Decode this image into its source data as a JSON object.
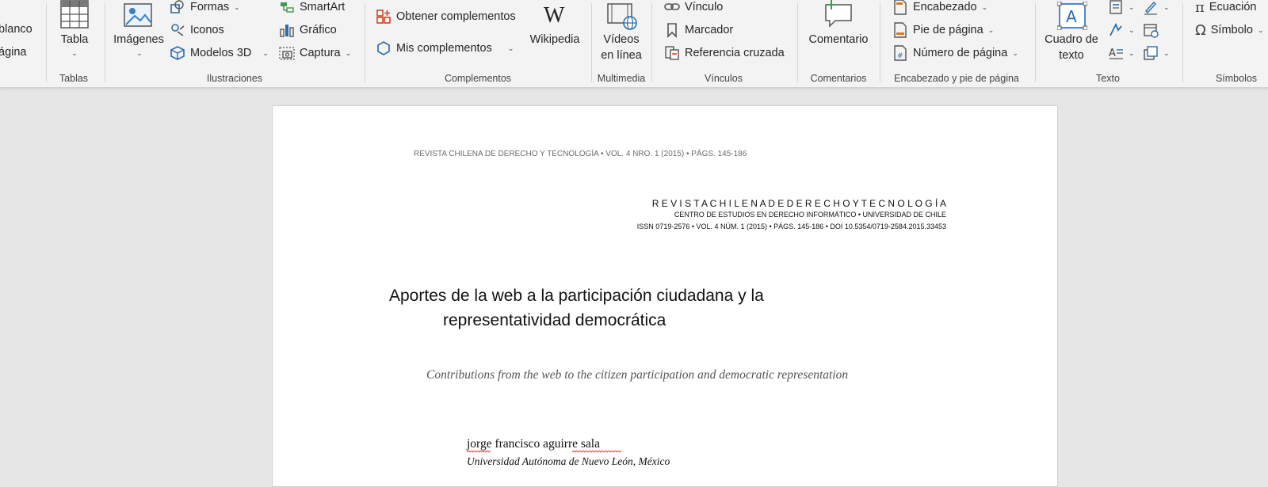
{
  "ribbon": {
    "cut_left": {
      "line1": "blanco",
      "line2": "ágina"
    },
    "tablas": {
      "button": "Tabla",
      "group": "Tablas"
    },
    "ilustraciones": {
      "imagenes": "Imágenes",
      "formas": "Formas",
      "iconos": "Iconos",
      "modelos3d": "Modelos 3D",
      "smartart": "SmartArt",
      "grafico": "Gráfico",
      "captura": "Captura",
      "group": "Ilustraciones"
    },
    "complementos": {
      "obtener": "Obtener complementos",
      "mis": "Mis complementos",
      "wikipedia": "Wikipedia",
      "group": "Complementos"
    },
    "multimedia": {
      "videos_line1": "Vídeos",
      "videos_line2": "en línea",
      "group": "Multimedia"
    },
    "vinculos": {
      "vinculo": "Vínculo",
      "marcador": "Marcador",
      "referencia": "Referencia cruzada",
      "group": "Vínculos"
    },
    "comentarios": {
      "comentario": "Comentario",
      "group": "Comentarios"
    },
    "encabezado": {
      "encabezado": "Encabezado",
      "pie": "Pie de página",
      "numero": "Número de página",
      "group": "Encabezado y pie de página"
    },
    "texto": {
      "cuadro_line1": "Cuadro de",
      "cuadro_line2": "texto",
      "group": "Texto"
    },
    "simbolos": {
      "ecuacion": "Ecuación",
      "simbolo": "Símbolo",
      "group": "Símbolos"
    }
  },
  "document": {
    "running_header": "REVISTA CHILENA DE DERECHO Y TECNOLOGÍA • VOL. 4 NRO. 1 (2015) • PÁGS. 145-186",
    "journal_title": "R E V I S T A C H I L E N A D E D E R E C H O Y T E C N O L O G Í A",
    "journal_center": "CENTRO DE ESTUDIOS EN DERECHO INFORMÁTICO • UNIVERSIDAD DE CHILE",
    "journal_issn": "ISSN 0719-2576 • VOL. 4 NÚM. 1 (2015) • PÁGS. 145-186 • DOI 10.5354/0719-2584.2015.33453",
    "title_line1": "Aportes de la web a la participación ciudadana y la",
    "title_line2": "representatividad democrática",
    "subtitle": "Contributions from the web to the citizen participation  and democratic representation",
    "author": "jorge francisco aguirre sala",
    "affiliation": "Universidad Autónoma de Nuevo León, México"
  }
}
